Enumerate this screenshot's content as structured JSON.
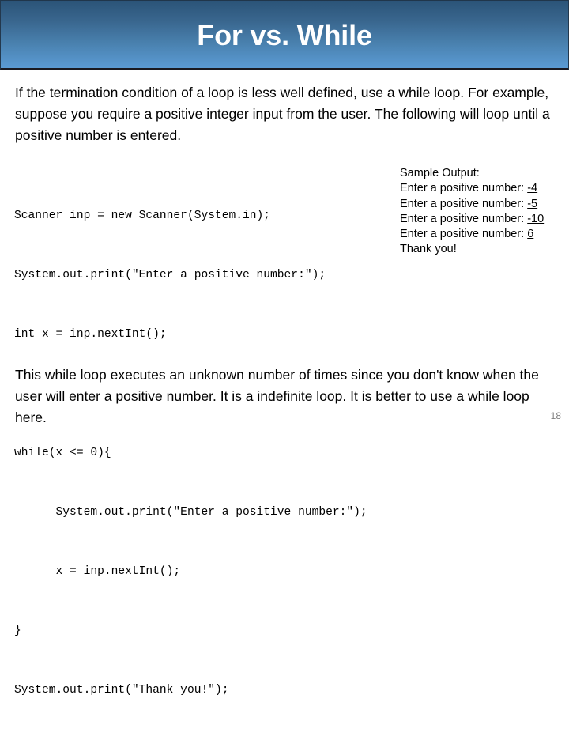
{
  "slide": {
    "title": "For vs. While",
    "number": "18",
    "intro_paragraph": "If the termination condition of a loop is less well defined, use a while loop. For example, suppose you require a positive integer input from the user. The following will loop until a positive number is entered.",
    "outro_paragraph": "This while loop executes an unknown number of times since you don't know when the user will enter a positive number. It is a indefinite loop. It is better to use a while loop here."
  },
  "code": {
    "lines": [
      "Scanner inp = new Scanner(System.in);",
      "System.out.print(\"Enter a positive number:\");",
      "int x = inp.nextInt();",
      "",
      "while(x <= 0){",
      "      System.out.print(\"Enter a positive number:\");",
      "      x = inp.nextInt();",
      "}",
      "System.out.print(\"Thank you!\");"
    ]
  },
  "sample_output": {
    "heading": "Sample Output:",
    "prompt": "Enter a positive number:",
    "entries": [
      {
        "prompt": "Enter a positive number:",
        "input": "-4"
      },
      {
        "prompt": "Enter a positive number:",
        "input": "-5"
      },
      {
        "prompt": "Enter a positive number:",
        "input": "-10"
      },
      {
        "prompt": "Enter a positive number:",
        "input": "6"
      }
    ],
    "final_line": "Thank you!"
  },
  "colors": {
    "banner_top": "#2b5478",
    "banner_bottom": "#5b9bd5",
    "banner_border": "#1a1a22",
    "title_text": "#ffffff",
    "body_text": "#000000",
    "slide_number": "#808080",
    "background": "#ffffff"
  }
}
